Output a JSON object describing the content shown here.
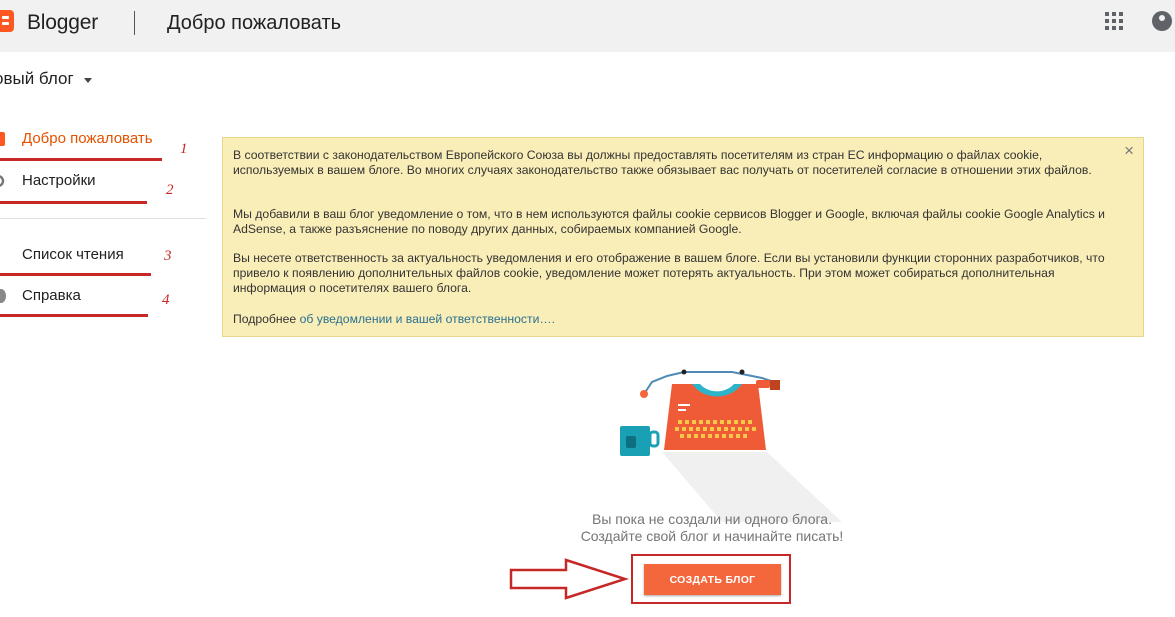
{
  "header": {
    "brand": "Blogger",
    "title": "Добро пожаловать"
  },
  "blog_selector": {
    "label": "овый блог"
  },
  "sidebar": {
    "items": [
      {
        "label": "Добро пожаловать",
        "annotation": "1",
        "active": true
      },
      {
        "label": "Настройки",
        "annotation": "2",
        "active": false
      },
      {
        "label": "Список чтения",
        "annotation": "3",
        "active": false
      },
      {
        "label": "Справка",
        "annotation": "4",
        "active": false
      }
    ]
  },
  "notice": {
    "close": "×",
    "p1": "В соответствии с законодательством Европейского Союза вы должны предоставлять посетителям из стран ЕС информацию о файлах cookie, используемых в вашем блоге. Во многих случаях законодательство также обязывает вас получать от посетителей согласие в отношении этих файлов.",
    "p2": "Мы добавили в ваш блог уведомление о том, что в нем используются файлы cookie сервисов Blogger и Google, включая файлы cookie Google Analytics и AdSense, а также разъяснение по поводу других данных, собираемых компанией Google.",
    "p3": "Вы несете ответственность за актуальность уведомления и его отображение в вашем блоге. Если вы установили функции сторонних разработчиков, что привело к появлению дополнительных файлов cookie, уведомление может потерять актуальность. При этом может собираться дополнительная информация о посетителях вашего блога.",
    "more_prefix": "Подробнее ",
    "more_link": "об уведомлении и вашей ответственности…."
  },
  "empty_state": {
    "line1": "Вы пока не создали ни одного блога.",
    "line2": "Создайте свой блог и начинайте писать!",
    "button": "СОЗДАТЬ БЛОГ"
  },
  "colors": {
    "accent": "#f4663b",
    "annotation_red": "#c62828",
    "notice_bg": "#faeeb8",
    "active_nav": "#e65100"
  }
}
